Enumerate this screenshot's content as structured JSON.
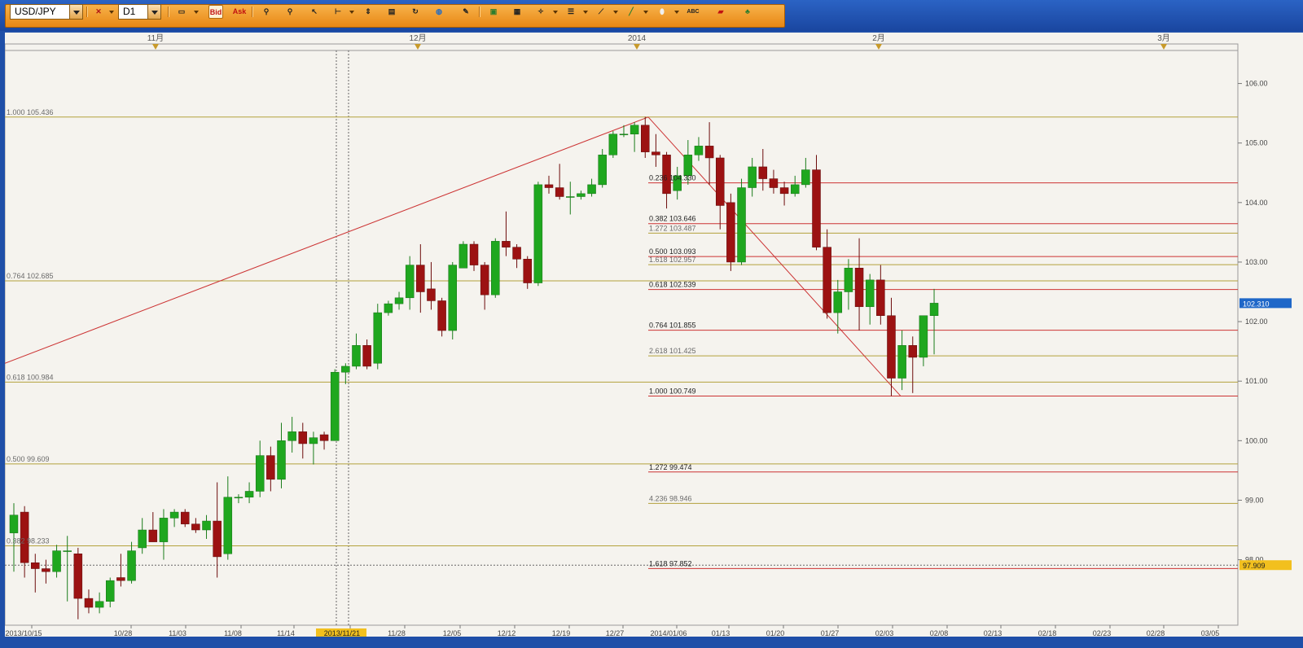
{
  "toolbar": {
    "symbol": "USD/JPY",
    "timeframe": "D1",
    "bid_label": "Bid",
    "ask_label": "Ask",
    "icons": [
      "order-icon",
      "line-chart-icon",
      "bid-button",
      "ask-button",
      "zoom-in-icon",
      "zoom-out-icon",
      "cursor-icon",
      "crosshair-icon",
      "period-separator-icon",
      "text-icon",
      "refresh-icon",
      "globe-icon",
      "pencil-icon",
      "image-icon",
      "window-icon",
      "tools-icon",
      "indicator-icon",
      "draw-line-icon",
      "trend-line-icon",
      "shape-icon",
      "abc-label-icon",
      "eraser-icon",
      "bank-icon"
    ]
  },
  "chart_data": {
    "type": "candlestick",
    "symbol": "USD/JPY",
    "timeframe": "D1",
    "ylim": [
      96.9,
      106.5
    ],
    "current_price": "102.310",
    "price_marker": "97.909",
    "yticks": [
      "106.00",
      "105.00",
      "104.00",
      "103.00",
      "102.00",
      "101.00",
      "100.00",
      "99.00",
      "98.00"
    ],
    "xticks": [
      "2013/10/15",
      "10/28",
      "11/03",
      "11/08",
      "11/14",
      "2013/11/21",
      "11/28",
      "12/05",
      "12/12",
      "12/19",
      "12/27",
      "2014/01/06",
      "01/13",
      "01/20",
      "01/27",
      "02/03",
      "02/08",
      "02/13",
      "02/18",
      "02/23",
      "02/28",
      "03/05"
    ],
    "month_labels": [
      "11月",
      "12月",
      "2014",
      "2月",
      "3月"
    ],
    "fib_retracement_left": [
      {
        "label": "1.000 105.436",
        "price": 105.436
      },
      {
        "label": "0.764 102.685",
        "price": 102.685
      },
      {
        "label": "0.618 100.984",
        "price": 100.984
      },
      {
        "label": "0.500 99.609",
        "price": 99.609
      },
      {
        "label": "0.382 98.233",
        "price": 98.233
      }
    ],
    "fib_retracement_right": [
      {
        "label": "0.236 104.330",
        "price": 104.33
      },
      {
        "label": "0.382 103.646",
        "price": 103.646
      },
      {
        "label": "0.500 103.093",
        "price": 103.093
      },
      {
        "label": "0.618 102.539",
        "price": 102.539
      },
      {
        "label": "0.764 101.855",
        "price": 101.855
      },
      {
        "label": "1.000 100.749",
        "price": 100.749
      },
      {
        "label": "1.272 99.474",
        "price": 99.474
      },
      {
        "label": "1.618 97.852",
        "price": 97.852
      }
    ],
    "fib_extension_right": [
      {
        "label": "1.272 103.487",
        "price": 103.487
      },
      {
        "label": "1.618 102.957",
        "price": 102.957
      },
      {
        "label": "2.618 101.425",
        "price": 101.425
      },
      {
        "label": "4.236 98.946",
        "price": 98.946
      }
    ],
    "candles": [
      {
        "date": "10/15",
        "o": 98.45,
        "h": 98.95,
        "l": 97.8,
        "c": 98.75
      },
      {
        "date": "10/16",
        "o": 98.8,
        "h": 98.9,
        "l": 97.7,
        "c": 97.95
      },
      {
        "date": "10/17",
        "o": 97.95,
        "h": 98.1,
        "l": 97.45,
        "c": 97.85
      },
      {
        "date": "10/18",
        "o": 97.85,
        "h": 98.0,
        "l": 97.6,
        "c": 97.8
      },
      {
        "date": "10/21",
        "o": 97.8,
        "h": 98.25,
        "l": 97.7,
        "c": 98.15
      },
      {
        "date": "10/22",
        "o": 98.15,
        "h": 98.4,
        "l": 97.3,
        "c": 98.15
      },
      {
        "date": "10/23",
        "o": 98.1,
        "h": 98.2,
        "l": 97.0,
        "c": 97.35
      },
      {
        "date": "10/24",
        "o": 97.35,
        "h": 97.5,
        "l": 97.1,
        "c": 97.2
      },
      {
        "date": "10/25",
        "o": 97.2,
        "h": 97.45,
        "l": 97.1,
        "c": 97.3
      },
      {
        "date": "10/28",
        "o": 97.3,
        "h": 97.7,
        "l": 97.2,
        "c": 97.65
      },
      {
        "date": "10/29",
        "o": 97.7,
        "h": 98.1,
        "l": 97.55,
        "c": 97.65
      },
      {
        "date": "10/30",
        "o": 97.65,
        "h": 98.3,
        "l": 97.6,
        "c": 98.15
      },
      {
        "date": "10/31",
        "o": 98.2,
        "h": 98.7,
        "l": 98.1,
        "c": 98.5
      },
      {
        "date": "11/01",
        "o": 98.5,
        "h": 98.8,
        "l": 98.3,
        "c": 98.3
      },
      {
        "date": "11/04",
        "o": 98.3,
        "h": 98.85,
        "l": 98.0,
        "c": 98.7
      },
      {
        "date": "11/05",
        "o": 98.7,
        "h": 98.85,
        "l": 98.55,
        "c": 98.8
      },
      {
        "date": "11/06",
        "o": 98.8,
        "h": 98.85,
        "l": 98.55,
        "c": 98.6
      },
      {
        "date": "11/07",
        "o": 98.6,
        "h": 98.7,
        "l": 98.45,
        "c": 98.5
      },
      {
        "date": "11/08",
        "o": 98.5,
        "h": 98.75,
        "l": 98.35,
        "c": 98.65
      },
      {
        "date": "11/11",
        "o": 98.65,
        "h": 99.3,
        "l": 97.7,
        "c": 98.05
      },
      {
        "date": "11/12",
        "o": 98.1,
        "h": 99.4,
        "l": 98.0,
        "c": 99.05
      },
      {
        "date": "11/13",
        "o": 99.05,
        "h": 99.1,
        "l": 98.95,
        "c": 99.05
      },
      {
        "date": "11/14",
        "o": 99.05,
        "h": 99.3,
        "l": 98.95,
        "c": 99.15
      },
      {
        "date": "11/15",
        "o": 99.15,
        "h": 100.0,
        "l": 99.05,
        "c": 99.75
      },
      {
        "date": "11/18",
        "o": 99.75,
        "h": 99.9,
        "l": 99.15,
        "c": 99.35
      },
      {
        "date": "11/19",
        "o": 99.35,
        "h": 100.3,
        "l": 99.2,
        "c": 100.0
      },
      {
        "date": "11/20",
        "o": 100.0,
        "h": 100.4,
        "l": 99.8,
        "c": 100.15
      },
      {
        "date": "11/21",
        "o": 100.15,
        "h": 100.3,
        "l": 99.7,
        "c": 99.95
      },
      {
        "date": "11/22",
        "o": 99.95,
        "h": 100.15,
        "l": 99.6,
        "c": 100.05
      },
      {
        "date": "11/25",
        "o": 100.1,
        "h": 100.15,
        "l": 99.85,
        "c": 100.0
      },
      {
        "date": "11/26",
        "o": 100.0,
        "h": 101.2,
        "l": 100.0,
        "c": 101.15
      },
      {
        "date": "11/27",
        "o": 101.15,
        "h": 101.3,
        "l": 100.95,
        "c": 101.25
      },
      {
        "date": "11/28",
        "o": 101.25,
        "h": 101.8,
        "l": 101.2,
        "c": 101.6
      },
      {
        "date": "11/29",
        "o": 101.6,
        "h": 101.7,
        "l": 101.2,
        "c": 101.25
      },
      {
        "date": "12/02",
        "o": 101.3,
        "h": 102.3,
        "l": 101.2,
        "c": 102.15
      },
      {
        "date": "12/03",
        "o": 102.15,
        "h": 102.35,
        "l": 102.1,
        "c": 102.3
      },
      {
        "date": "12/04",
        "o": 102.3,
        "h": 102.5,
        "l": 102.2,
        "c": 102.4
      },
      {
        "date": "12/05",
        "o": 102.4,
        "h": 103.1,
        "l": 102.2,
        "c": 102.95
      },
      {
        "date": "12/06",
        "o": 102.95,
        "h": 103.3,
        "l": 102.15,
        "c": 102.5
      },
      {
        "date": "12/09",
        "o": 102.55,
        "h": 103.0,
        "l": 102.2,
        "c": 102.35
      },
      {
        "date": "12/10",
        "o": 102.35,
        "h": 102.4,
        "l": 101.75,
        "c": 101.85
      },
      {
        "date": "12/11",
        "o": 101.85,
        "h": 103.0,
        "l": 101.7,
        "c": 102.95
      },
      {
        "date": "12/12",
        "o": 102.9,
        "h": 103.35,
        "l": 102.9,
        "c": 103.3
      },
      {
        "date": "12/13",
        "o": 103.3,
        "h": 103.35,
        "l": 102.85,
        "c": 102.95
      },
      {
        "date": "12/16",
        "o": 102.95,
        "h": 103.0,
        "l": 102.2,
        "c": 102.45
      },
      {
        "date": "12/17",
        "o": 102.45,
        "h": 103.4,
        "l": 102.4,
        "c": 103.35
      },
      {
        "date": "12/18",
        "o": 103.35,
        "h": 103.85,
        "l": 103.1,
        "c": 103.25
      },
      {
        "date": "12/19",
        "o": 103.25,
        "h": 103.3,
        "l": 102.9,
        "c": 103.05
      },
      {
        "date": "12/20",
        "o": 103.05,
        "h": 103.1,
        "l": 102.55,
        "c": 102.65
      },
      {
        "date": "12/23",
        "o": 102.65,
        "h": 104.35,
        "l": 102.6,
        "c": 104.3
      },
      {
        "date": "12/24",
        "o": 104.3,
        "h": 104.45,
        "l": 104.15,
        "c": 104.25
      },
      {
        "date": "12/25",
        "o": 104.25,
        "h": 104.65,
        "l": 104.05,
        "c": 104.1
      },
      {
        "date": "12/26",
        "o": 104.1,
        "h": 104.35,
        "l": 103.8,
        "c": 104.1
      },
      {
        "date": "12/27",
        "o": 104.1,
        "h": 104.2,
        "l": 104.05,
        "c": 104.15
      },
      {
        "date": "12/30",
        "o": 104.15,
        "h": 104.4,
        "l": 104.1,
        "c": 104.3
      },
      {
        "date": "12/31",
        "o": 104.3,
        "h": 104.9,
        "l": 104.25,
        "c": 104.8
      },
      {
        "date": "01/02",
        "o": 104.8,
        "h": 105.2,
        "l": 104.75,
        "c": 105.15
      },
      {
        "date": "01/03",
        "o": 105.15,
        "h": 105.3,
        "l": 105.1,
        "c": 105.15
      },
      {
        "date": "01/06",
        "o": 105.15,
        "h": 105.35,
        "l": 104.85,
        "c": 105.3
      },
      {
        "date": "01/07",
        "o": 105.3,
        "h": 105.44,
        "l": 104.75,
        "c": 104.85
      },
      {
        "date": "01/08",
        "o": 104.85,
        "h": 105.15,
        "l": 104.6,
        "c": 104.8
      },
      {
        "date": "01/09",
        "o": 104.8,
        "h": 104.85,
        "l": 103.9,
        "c": 104.15
      },
      {
        "date": "01/10",
        "o": 104.2,
        "h": 104.6,
        "l": 104.05,
        "c": 104.45
      },
      {
        "date": "01/13",
        "o": 104.45,
        "h": 105.05,
        "l": 104.3,
        "c": 104.8
      },
      {
        "date": "01/14",
        "o": 104.8,
        "h": 105.1,
        "l": 104.7,
        "c": 104.95
      },
      {
        "date": "01/15",
        "o": 104.95,
        "h": 105.35,
        "l": 104.3,
        "c": 104.75
      },
      {
        "date": "01/16",
        "o": 104.75,
        "h": 104.8,
        "l": 103.55,
        "c": 103.95
      },
      {
        "date": "01/17",
        "o": 104.0,
        "h": 104.15,
        "l": 102.85,
        "c": 103.0
      },
      {
        "date": "01/20",
        "o": 103.0,
        "h": 104.4,
        "l": 102.95,
        "c": 104.25
      },
      {
        "date": "01/21",
        "o": 104.25,
        "h": 104.75,
        "l": 104.1,
        "c": 104.6
      },
      {
        "date": "01/22",
        "o": 104.6,
        "h": 104.9,
        "l": 104.2,
        "c": 104.4
      },
      {
        "date": "01/23",
        "o": 104.4,
        "h": 104.55,
        "l": 104.15,
        "c": 104.25
      },
      {
        "date": "01/24",
        "o": 104.25,
        "h": 104.35,
        "l": 103.95,
        "c": 104.15
      },
      {
        "date": "01/27",
        "o": 104.15,
        "h": 104.45,
        "l": 104.1,
        "c": 104.3
      },
      {
        "date": "01/28",
        "o": 104.3,
        "h": 104.75,
        "l": 104.25,
        "c": 104.55
      },
      {
        "date": "01/29",
        "o": 104.55,
        "h": 104.8,
        "l": 103.2,
        "c": 103.25
      },
      {
        "date": "01/30",
        "o": 103.25,
        "h": 103.55,
        "l": 102.05,
        "c": 102.15
      },
      {
        "date": "01/31",
        "o": 102.15,
        "h": 102.7,
        "l": 101.8,
        "c": 102.5
      },
      {
        "date": "02/03",
        "o": 102.5,
        "h": 103.05,
        "l": 102.2,
        "c": 102.9
      },
      {
        "date": "02/04",
        "o": 102.9,
        "h": 103.4,
        "l": 101.85,
        "c": 102.25
      },
      {
        "date": "02/05",
        "o": 102.25,
        "h": 102.8,
        "l": 101.95,
        "c": 102.7
      },
      {
        "date": "02/06",
        "o": 102.7,
        "h": 102.95,
        "l": 101.95,
        "c": 102.1
      },
      {
        "date": "02/07",
        "o": 102.1,
        "h": 102.4,
        "l": 100.75,
        "c": 101.05
      },
      {
        "date": "02/10",
        "o": 101.05,
        "h": 101.85,
        "l": 100.85,
        "c": 101.6
      },
      {
        "date": "02/11",
        "o": 101.6,
        "h": 101.75,
        "l": 100.8,
        "c": 101.4
      },
      {
        "date": "02/12",
        "o": 101.4,
        "h": 102.1,
        "l": 101.25,
        "c": 102.1
      },
      {
        "date": "02/13",
        "o": 102.1,
        "h": 102.55,
        "l": 101.45,
        "c": 102.31
      }
    ]
  }
}
